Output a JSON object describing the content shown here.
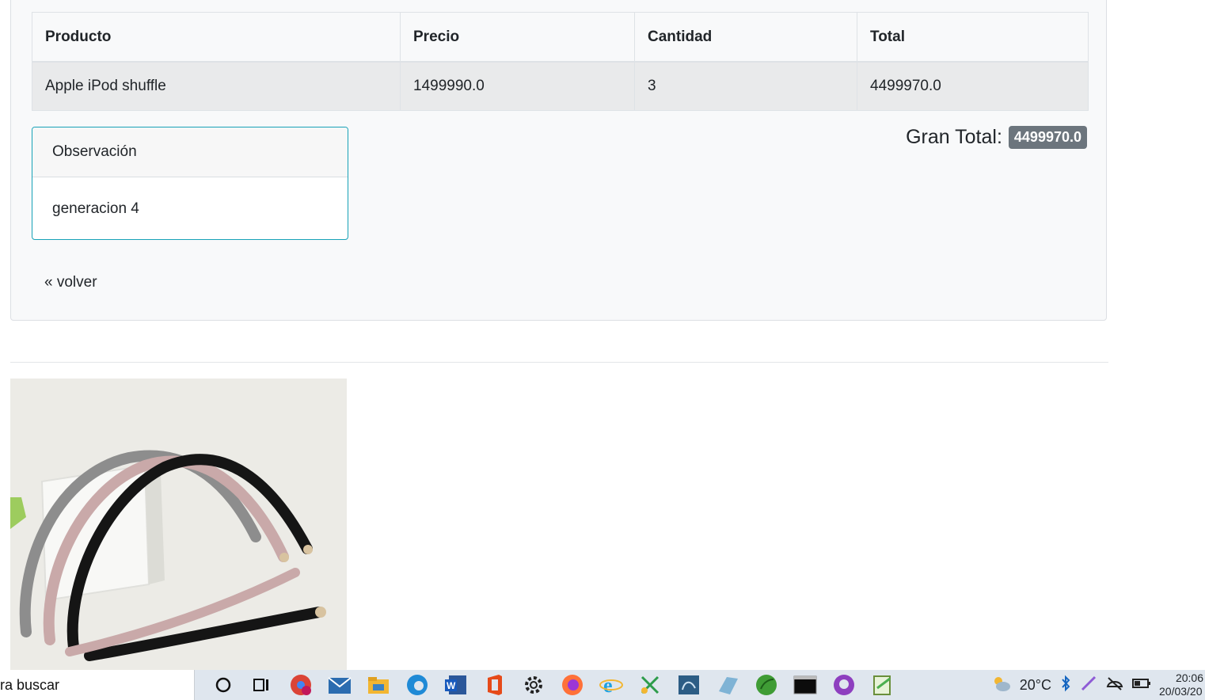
{
  "table": {
    "headers": [
      "Producto",
      "Precio",
      "Cantidad",
      "Total"
    ],
    "rows": [
      [
        "Apple iPod shuffle",
        "1499990.0",
        "3",
        "4499970.0"
      ]
    ]
  },
  "observation": {
    "title": "Observación",
    "text": "generacion 4"
  },
  "grand_total": {
    "label": "Gran Total:",
    "value": "4499970.0"
  },
  "back_link": "« volver",
  "taskbar": {
    "search_text": "ra buscar",
    "temperature": "20°C",
    "time": "20:06",
    "date": "20/03/20"
  },
  "colors": {
    "card_bg": "#f8f9fa",
    "observation_border": "#17a2b8",
    "badge_bg": "#6c757d"
  }
}
